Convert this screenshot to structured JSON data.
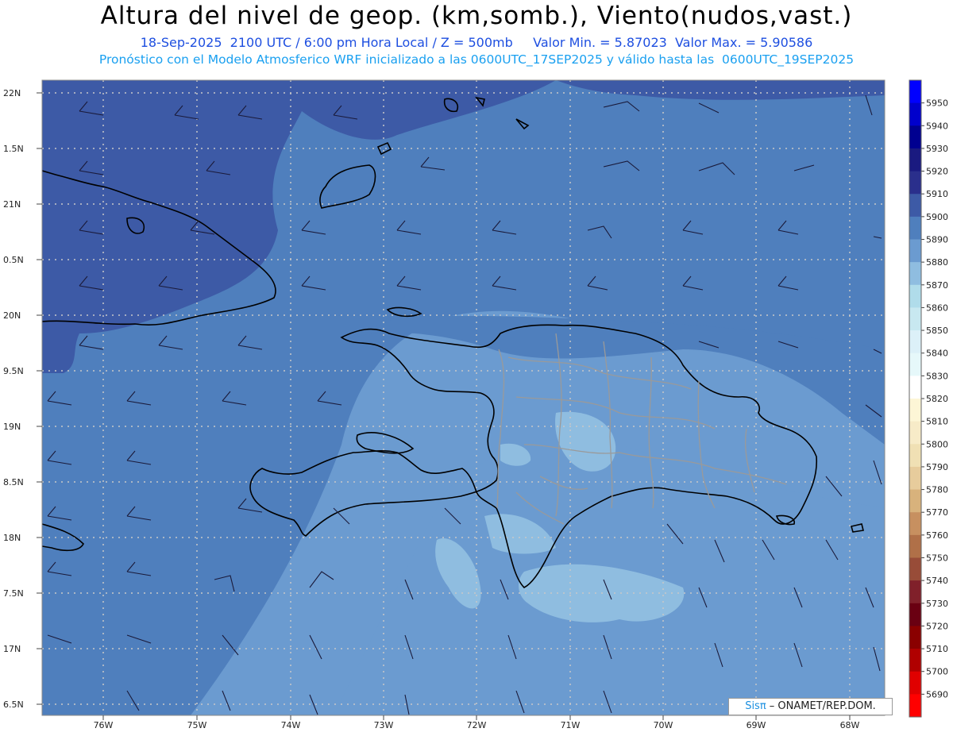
{
  "header": {
    "title": "Altura del nivel de geop. (km,somb.), Viento(nudos,vast.)",
    "info_line": "18-Sep-2025  2100 UTC / 6:00 pm Hora Local / Z = 500mb     Valor Min. = 5.87023  Valor Max. = 5.90586",
    "model_line": "Pronóstico con el Modelo Atmosferico WRF inicializado a las 0600UTC_17SEP2025 y válido hasta las  0600UTC_19SEP2025"
  },
  "map": {
    "lat_labels": [
      "22N",
      "1.5N",
      "21N",
      "0.5N",
      "20N",
      "9.5N",
      "19N",
      "8.5N",
      "18N",
      "7.5N",
      "17N",
      "6.5N"
    ],
    "lon_labels": [
      "76W",
      "75W",
      "74W",
      "73W",
      "72W",
      "71W",
      "70W",
      "69W",
      "68W"
    ],
    "colors": {
      "shade_dark": "#3d5aa6",
      "shade_mid": "#4f7fbd",
      "shade_light": "#6b9bd0",
      "shade_pale": "#8fbde0",
      "coast": "#000000",
      "provinces": "#9a9a9a",
      "grid": "#c8c8c8"
    }
  },
  "colorbar": {
    "levels": [
      {
        "value": "5950",
        "color": "#0000ff"
      },
      {
        "value": "5940",
        "color": "#0000cc"
      },
      {
        "value": "5930",
        "color": "#000090"
      },
      {
        "value": "5920",
        "color": "#1a1a80"
      },
      {
        "value": "5910",
        "color": "#2a2f8c"
      },
      {
        "value": "5900",
        "color": "#3d5aa6"
      },
      {
        "value": "5890",
        "color": "#4f7fbd"
      },
      {
        "value": "5880",
        "color": "#6b9bd0"
      },
      {
        "value": "5870",
        "color": "#8fbde0"
      },
      {
        "value": "5860",
        "color": "#b0dcea"
      },
      {
        "value": "5850",
        "color": "#c8e8f0"
      },
      {
        "value": "5840",
        "color": "#dcf0f8"
      },
      {
        "value": "5830",
        "color": "#e6f8fa"
      },
      {
        "value": "5820",
        "color": "#ffffff"
      },
      {
        "value": "5810",
        "color": "#fdf6d6"
      },
      {
        "value": "5800",
        "color": "#f7ebc8"
      },
      {
        "value": "5790",
        "color": "#f0e0b4"
      },
      {
        "value": "5780",
        "color": "#e7cc9c"
      },
      {
        "value": "5770",
        "color": "#d8b27c"
      },
      {
        "value": "5760",
        "color": "#c79060"
      },
      {
        "value": "5750",
        "color": "#b07048"
      },
      {
        "value": "5740",
        "color": "#984c38"
      },
      {
        "value": "5730",
        "color": "#80202a"
      },
      {
        "value": "5720",
        "color": "#6a0012"
      },
      {
        "value": "5710",
        "color": "#8a0000"
      },
      {
        "value": "5700",
        "color": "#b00000"
      },
      {
        "value": "5690",
        "color": "#e00000"
      },
      {
        "value": "",
        "color": "#ff0000"
      }
    ]
  },
  "credit": {
    "sis": "Sisπ",
    "text": " – ONAMET/REP.DOM."
  }
}
